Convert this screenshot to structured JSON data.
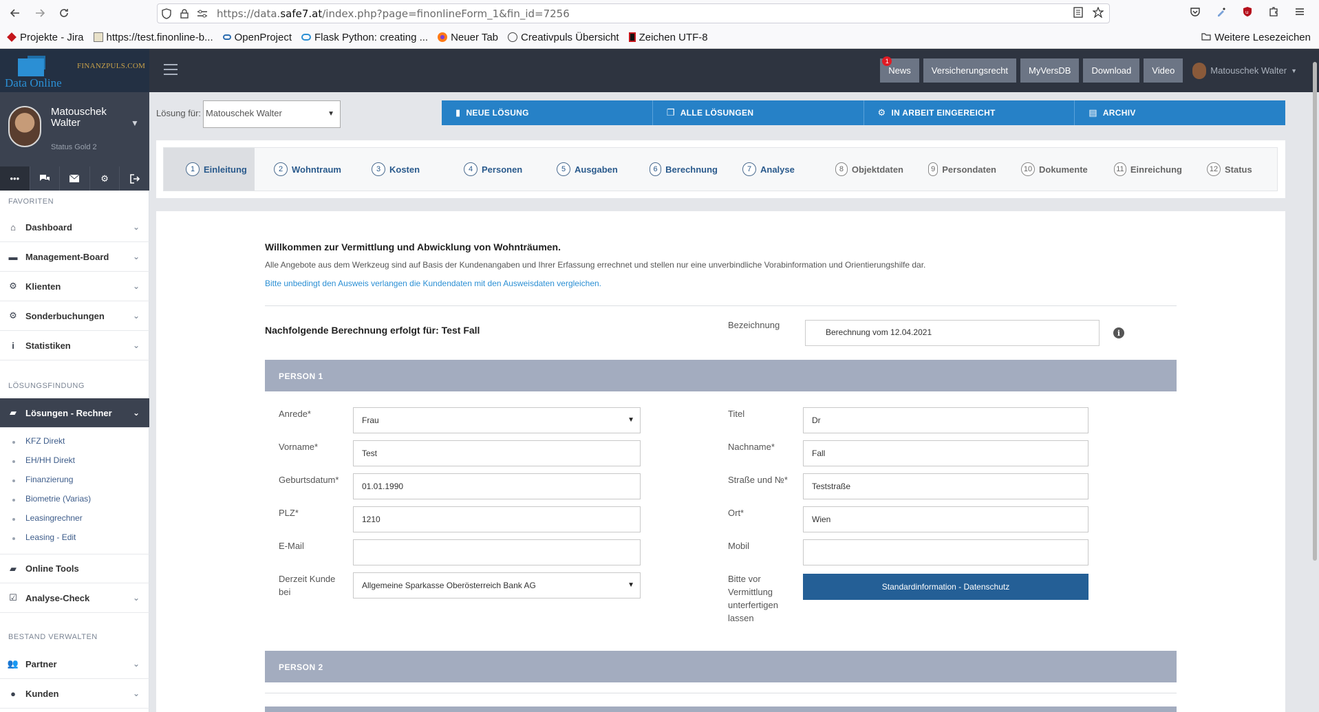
{
  "browser": {
    "url_prefix": "https://data.",
    "url_domain": "safe7.at",
    "url_rest": "/index.php?page=finonlineForm_1&fin_id=7256",
    "bookmarks": [
      "Projekte - Jira",
      "https://test.finonline-b...",
      "OpenProject",
      "Flask Python: creating ...",
      "Neuer Tab",
      "Creativpuls Übersicht",
      "Zeichen UTF-8"
    ],
    "bookmarks_right": "Weitere Lesezeichen"
  },
  "header": {
    "logo_text": "Data Online",
    "logo_partner": "FINANZPULS.COM",
    "buttons": [
      "News",
      "Versicherungsrecht",
      "MyVersDB",
      "Download",
      "Video"
    ],
    "news_badge": "1",
    "user_name": "Matouschek Walter"
  },
  "profile": {
    "first": "Matouschek",
    "last": "Walter",
    "status": "Status Gold 2"
  },
  "sidebar": {
    "section_favoriten": "FAVORITEN",
    "favoriten": [
      "Dashboard",
      "Management-Board",
      "Klienten",
      "Sonderbuchungen",
      "Statistiken"
    ],
    "section_loesung": "LÖSUNGSFINDUNG",
    "active_item": "Lösungen - Rechner",
    "sub_items": [
      "KFZ Direkt",
      "EH/HH Direkt",
      "Finanzierung",
      "Biometrie (Varias)",
      "Leasingrechner",
      "Leasing - Edit"
    ],
    "online_tools": "Online Tools",
    "analyse": "Analyse-Check",
    "section_bestand": "BESTAND VERWALTEN",
    "bestand": [
      "Partner",
      "Kunden"
    ]
  },
  "toolbar": {
    "loesung_label": "Lösung für:",
    "loesung_value": "Matouschek Walter",
    "actions": [
      "NEUE LÖSUNG",
      "ALLE LÖSUNGEN",
      "IN ARBEIT EINGEREICHT",
      "ARCHIV"
    ]
  },
  "steps": [
    {
      "num": "1",
      "label": "Einleitung"
    },
    {
      "num": "2",
      "label": "Wohntraum"
    },
    {
      "num": "3",
      "label": "Kosten"
    },
    {
      "num": "4",
      "label": "Personen"
    },
    {
      "num": "5",
      "label": "Ausgaben"
    },
    {
      "num": "6",
      "label": "Berechnung"
    },
    {
      "num": "7",
      "label": "Analyse"
    },
    {
      "num": "8",
      "label": "Objektdaten"
    },
    {
      "num": "9",
      "label": "Persondaten"
    },
    {
      "num": "10",
      "label": "Dokumente"
    },
    {
      "num": "11",
      "label": "Einreichung"
    },
    {
      "num": "12",
      "label": "Status"
    }
  ],
  "content": {
    "welcome_title": "Willkommen zur Vermittlung und Abwicklung von Wohnträumen.",
    "welcome_text": "Alle Angebote aus dem Werkzeug sind auf Basis der Kundenangaben und Ihrer Erfassung errechnet und stellen nur eine unverbindliche Vorabinformation und Orientierungshilfe dar.",
    "welcome_link": "Bitte unbedingt den Ausweis verlangen die Kundendaten mit den Ausweisdaten vergleichen.",
    "calc_for": "Nachfolgende Berechnung erfolgt für: Test Fall",
    "bez_label": "Bezeichnung",
    "bez_value": "Berechnung vom 12.04.2021",
    "info_glyph": "i",
    "person1": "PERSON 1",
    "person2": "PERSON 2"
  },
  "form": {
    "anrede_label": "Anrede*",
    "anrede_value": "Frau",
    "titel_label": "Titel",
    "titel_value": "Dr",
    "vorname_label": "Vorname*",
    "vorname_value": "Test",
    "nachname_label": "Nachname*",
    "nachname_value": "Fall",
    "geb_label": "Geburtsdatum*",
    "geb_value": "01.01.1990",
    "strasse_label": "Straße und №*",
    "strasse_value": "Teststraße",
    "plz_label": "PLZ*",
    "plz_value": "1210",
    "ort_label": "Ort*",
    "ort_value": "Wien",
    "email_label": "E-Mail",
    "email_value": "",
    "mobil_label": "Mobil",
    "mobil_value": "",
    "kunde_label": "Derzeit Kunde bei",
    "kunde_value": "Allgemeine Sparkasse Oberösterreich Bank AG",
    "vermittlung_label": "Bitte vor Vermittlung unterfertigen lassen",
    "datenschutz_btn": "Standardinformation - Datenschutz"
  }
}
